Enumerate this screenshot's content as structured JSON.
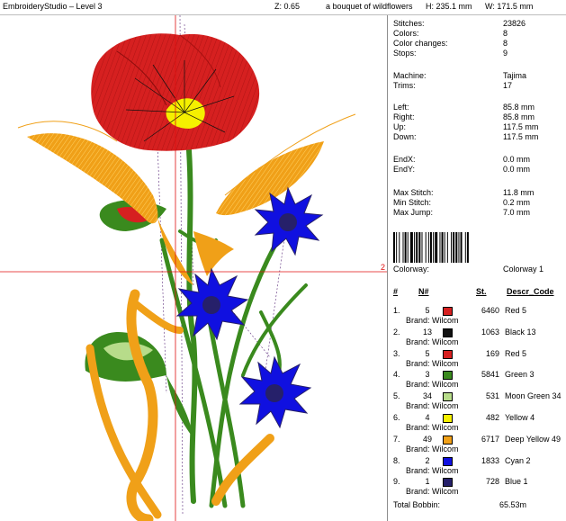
{
  "topbar": {
    "app_title": "EmbroideryStudio – Level 3",
    "zoom": "Z: 0.65",
    "design_name": "a bouquet of wildflowers",
    "height": "H: 235.1 mm",
    "width": "W: 171.5 mm"
  },
  "canvas": {
    "crosshair_label": "2"
  },
  "stats": [
    {
      "label": "Stitches:",
      "value": "23826"
    },
    {
      "label": "Colors:",
      "value": "8"
    },
    {
      "label": "Color changes:",
      "value": "8"
    },
    {
      "label": "Stops:",
      "value": "9"
    },
    {
      "label": "Machine:",
      "value": "Tajima"
    },
    {
      "label": "Trims:",
      "value": "17"
    },
    {
      "label": "Left:",
      "value": "85.8 mm"
    },
    {
      "label": "Right:",
      "value": "85.8 mm"
    },
    {
      "label": "Up:",
      "value": "117.5 mm"
    },
    {
      "label": "Down:",
      "value": "117.5 mm"
    },
    {
      "label": "EndX:",
      "value": "0.0 mm"
    },
    {
      "label": "EndY:",
      "value": "0.0 mm"
    },
    {
      "label": "Max Stitch:",
      "value": "11.8 mm"
    },
    {
      "label": "Min Stitch:",
      "value": "0.2 mm"
    },
    {
      "label": "Max Jump:",
      "value": "7.0 mm"
    }
  ],
  "colorway": {
    "label": "Colorway:",
    "value": "Colorway 1"
  },
  "table_headers": {
    "num": "#",
    "n": "N#",
    "st": "St.",
    "descr": "Descr_Code"
  },
  "colors": [
    {
      "index": "1.",
      "n": "5",
      "brand": "Brand: Wilcom",
      "stitches": "6460",
      "descr": "Red 5",
      "color": "#d62020"
    },
    {
      "index": "2.",
      "n": "13",
      "brand": "Brand: Wilcom",
      "stitches": "1063",
      "descr": "Black 13",
      "color": "#111111"
    },
    {
      "index": "3.",
      "n": "5",
      "brand": "Brand: Wilcom",
      "stitches": "169",
      "descr": "Red 5",
      "color": "#d62020"
    },
    {
      "index": "4.",
      "n": "3",
      "brand": "Brand: Wilcom",
      "stitches": "5841",
      "descr": "Green 3",
      "color": "#3a8a1e"
    },
    {
      "index": "5.",
      "n": "34",
      "brand": "Brand: Wilcom",
      "stitches": "531",
      "descr": "Moon Green 34",
      "color": "#b7dc8a"
    },
    {
      "index": "6.",
      "n": "4",
      "brand": "Brand: Wilcom",
      "stitches": "482",
      "descr": "Yellow 4",
      "color": "#f5f000"
    },
    {
      "index": "7.",
      "n": "49",
      "brand": "Brand: Wilcom",
      "stitches": "6717",
      "descr": "Deep Yellow 49",
      "color": "#f0a018"
    },
    {
      "index": "8.",
      "n": "2",
      "brand": "Brand: Wilcom",
      "stitches": "1833",
      "descr": "Cyan 2",
      "color": "#1010e0"
    },
    {
      "index": "9.",
      "n": "1",
      "brand": "Brand: Wilcom",
      "stitches": "728",
      "descr": "Blue 1",
      "color": "#26206a"
    }
  ],
  "total_bobbin": {
    "label": "Total Bobbin:",
    "value": "65.53m"
  }
}
